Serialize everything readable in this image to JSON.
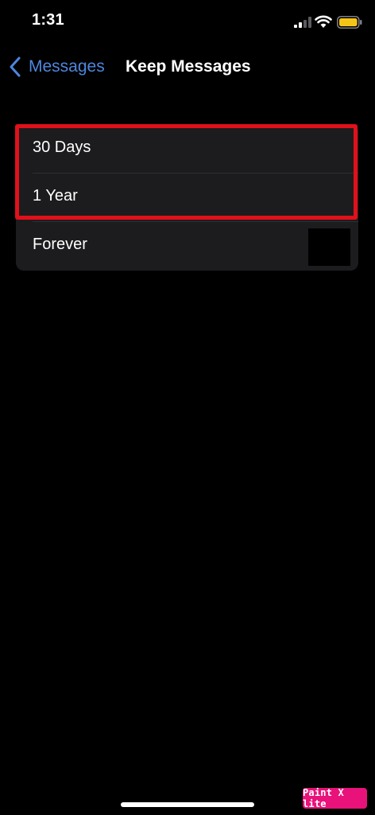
{
  "status_bar": {
    "time": "1:31",
    "icons": [
      "signal-icon",
      "wifi-icon",
      "battery-icon"
    ],
    "battery_color": "#f5c518"
  },
  "nav": {
    "back_label": "Messages",
    "back_icon": "chevron-left-icon",
    "title": "Keep Messages",
    "accent_color": "#4d86dc"
  },
  "options": [
    {
      "label": "30 Days"
    },
    {
      "label": "1 Year"
    },
    {
      "label": "Forever"
    }
  ],
  "annotation": {
    "color": "#e1101a",
    "highlights": [
      "30 Days",
      "1 Year"
    ]
  },
  "watermark": {
    "text": "Paint X lite",
    "color": "#e8127a"
  }
}
